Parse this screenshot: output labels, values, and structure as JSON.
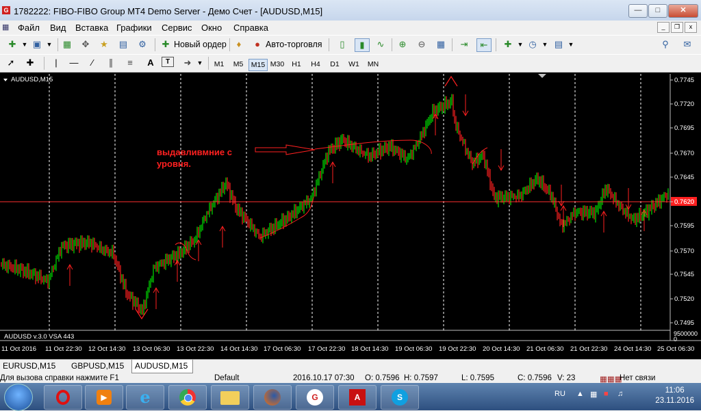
{
  "window": {
    "title": "1782222: FIBO-FIBO Group MT4 Demo Server - Демо Счет - [AUDUSD,M15]",
    "app_icon_letter": "G"
  },
  "menu": [
    "Файл",
    "Вид",
    "Вставка",
    "Графики",
    "Сервис",
    "Окно",
    "Справка"
  ],
  "toolbar1": {
    "new_order": "Новый ордер",
    "auto_trading": "Авто-торговля"
  },
  "timeframes": [
    "M1",
    "M5",
    "M15",
    "M30",
    "H1",
    "H4",
    "D1",
    "W1",
    "MN"
  ],
  "active_timeframe": "M15",
  "chart": {
    "symbol_label": "AUDUSD,M15",
    "annotation_line1": "выдавливмние с",
    "annotation_line2": "уровня.",
    "current_price": "0.7620",
    "price_ticks": [
      "0.7745",
      "0.7720",
      "0.7695",
      "0.7670",
      "0.7645",
      "0.7620",
      "0.7595",
      "0.7570",
      "0.7545",
      "0.7520",
      "0.7495"
    ],
    "indicator_label": "AUDUSD v.3.0 VSA 443",
    "indicator_scale": "9500000",
    "indicator_zero": "0",
    "time_labels": [
      "11 Oct 2016",
      "11 Oct 22:30",
      "12 Oct 14:30",
      "13 Oct 06:30",
      "13 Oct 22:30",
      "14 Oct 14:30",
      "17 Oct 06:30",
      "17 Oct 22:30",
      "18 Oct 14:30",
      "19 Oct 06:30",
      "19 Oct 22:30",
      "20 Oct 14:30",
      "21 Oct 06:30",
      "21 Oct 22:30",
      "24 Oct 14:30",
      "25 Oct 06:30"
    ],
    "colors": {
      "background": "#000000",
      "bull": "#00e000",
      "bear": "#ff2020",
      "level": "#ff3030",
      "annotation": "#ff2020",
      "grid": "#ffffff"
    }
  },
  "tabs": [
    "EURUSD,M15",
    "GBPUSD,M15",
    "AUDUSD,M15"
  ],
  "active_tab": "AUDUSD,M15",
  "status": {
    "help": "Для вызова справки нажмите F1",
    "profile": "Default",
    "datetime": "2016.10.17 07:30",
    "open": "O: 0.7596",
    "high": "H: 0.7597",
    "low": "L: 0.7595",
    "close": "C: 0.7596",
    "volume": "V: 23",
    "connection": "Нет связи"
  },
  "taskbar": {
    "lang": "RU",
    "time": "11:06",
    "date": "23.11.2016"
  }
}
